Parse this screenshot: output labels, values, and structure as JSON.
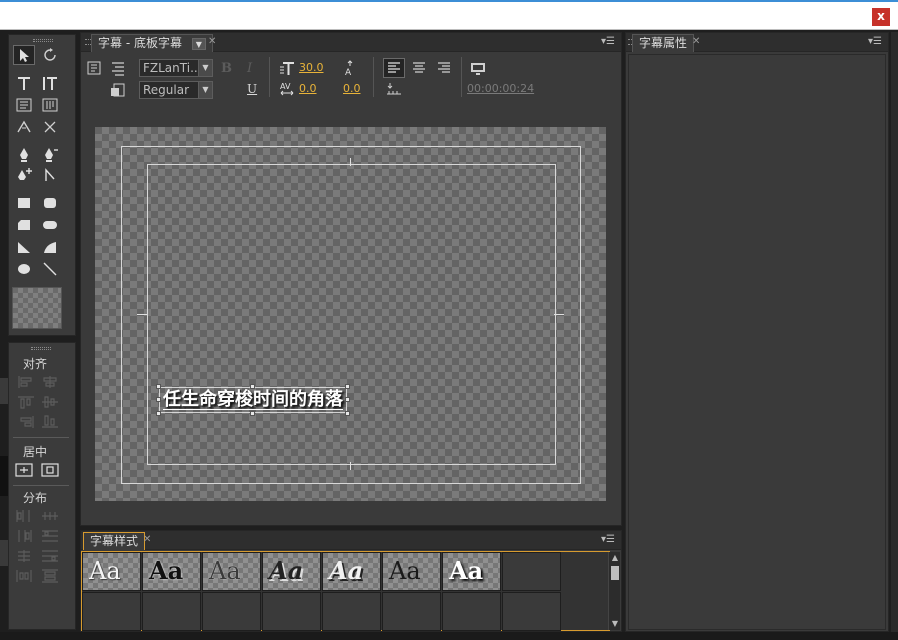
{
  "window": {
    "close_label": "x"
  },
  "designer": {
    "tab_label": "字幕 - 底板字幕",
    "font_family": "FZLanTi...",
    "font_style": "Regular",
    "bold_label": "B",
    "italic_label": "I",
    "underline_label": "U",
    "font_size": "30.0",
    "kerning": "0.0",
    "leading": "0.0",
    "timecode": "00:00:00:24",
    "title_text": "任生命穿梭时间的角落"
  },
  "styles_panel": {
    "tab_label": "字幕样式",
    "swatch_text": "Aa",
    "swatches": [
      {
        "text": "Aa",
        "style": "plain"
      },
      {
        "text": "Aa",
        "style": "black"
      },
      {
        "text": "Aa",
        "style": "grey"
      },
      {
        "text": "Aa",
        "style": "script-dark"
      },
      {
        "text": "Aa",
        "style": "script-light"
      },
      {
        "text": "Aa",
        "style": "dark"
      },
      {
        "text": "Aa",
        "style": "white-shadow"
      }
    ]
  },
  "properties_panel": {
    "tab_label": "字幕属性"
  },
  "align_panel": {
    "align_label": "对齐",
    "center_label": "居中",
    "distribute_label": "分布"
  },
  "colors": {
    "panel_bg": "#3a3a3a",
    "accent_orange": "#d79b2f",
    "value_yellow": "#e8b339",
    "close_red": "#c6322a"
  }
}
